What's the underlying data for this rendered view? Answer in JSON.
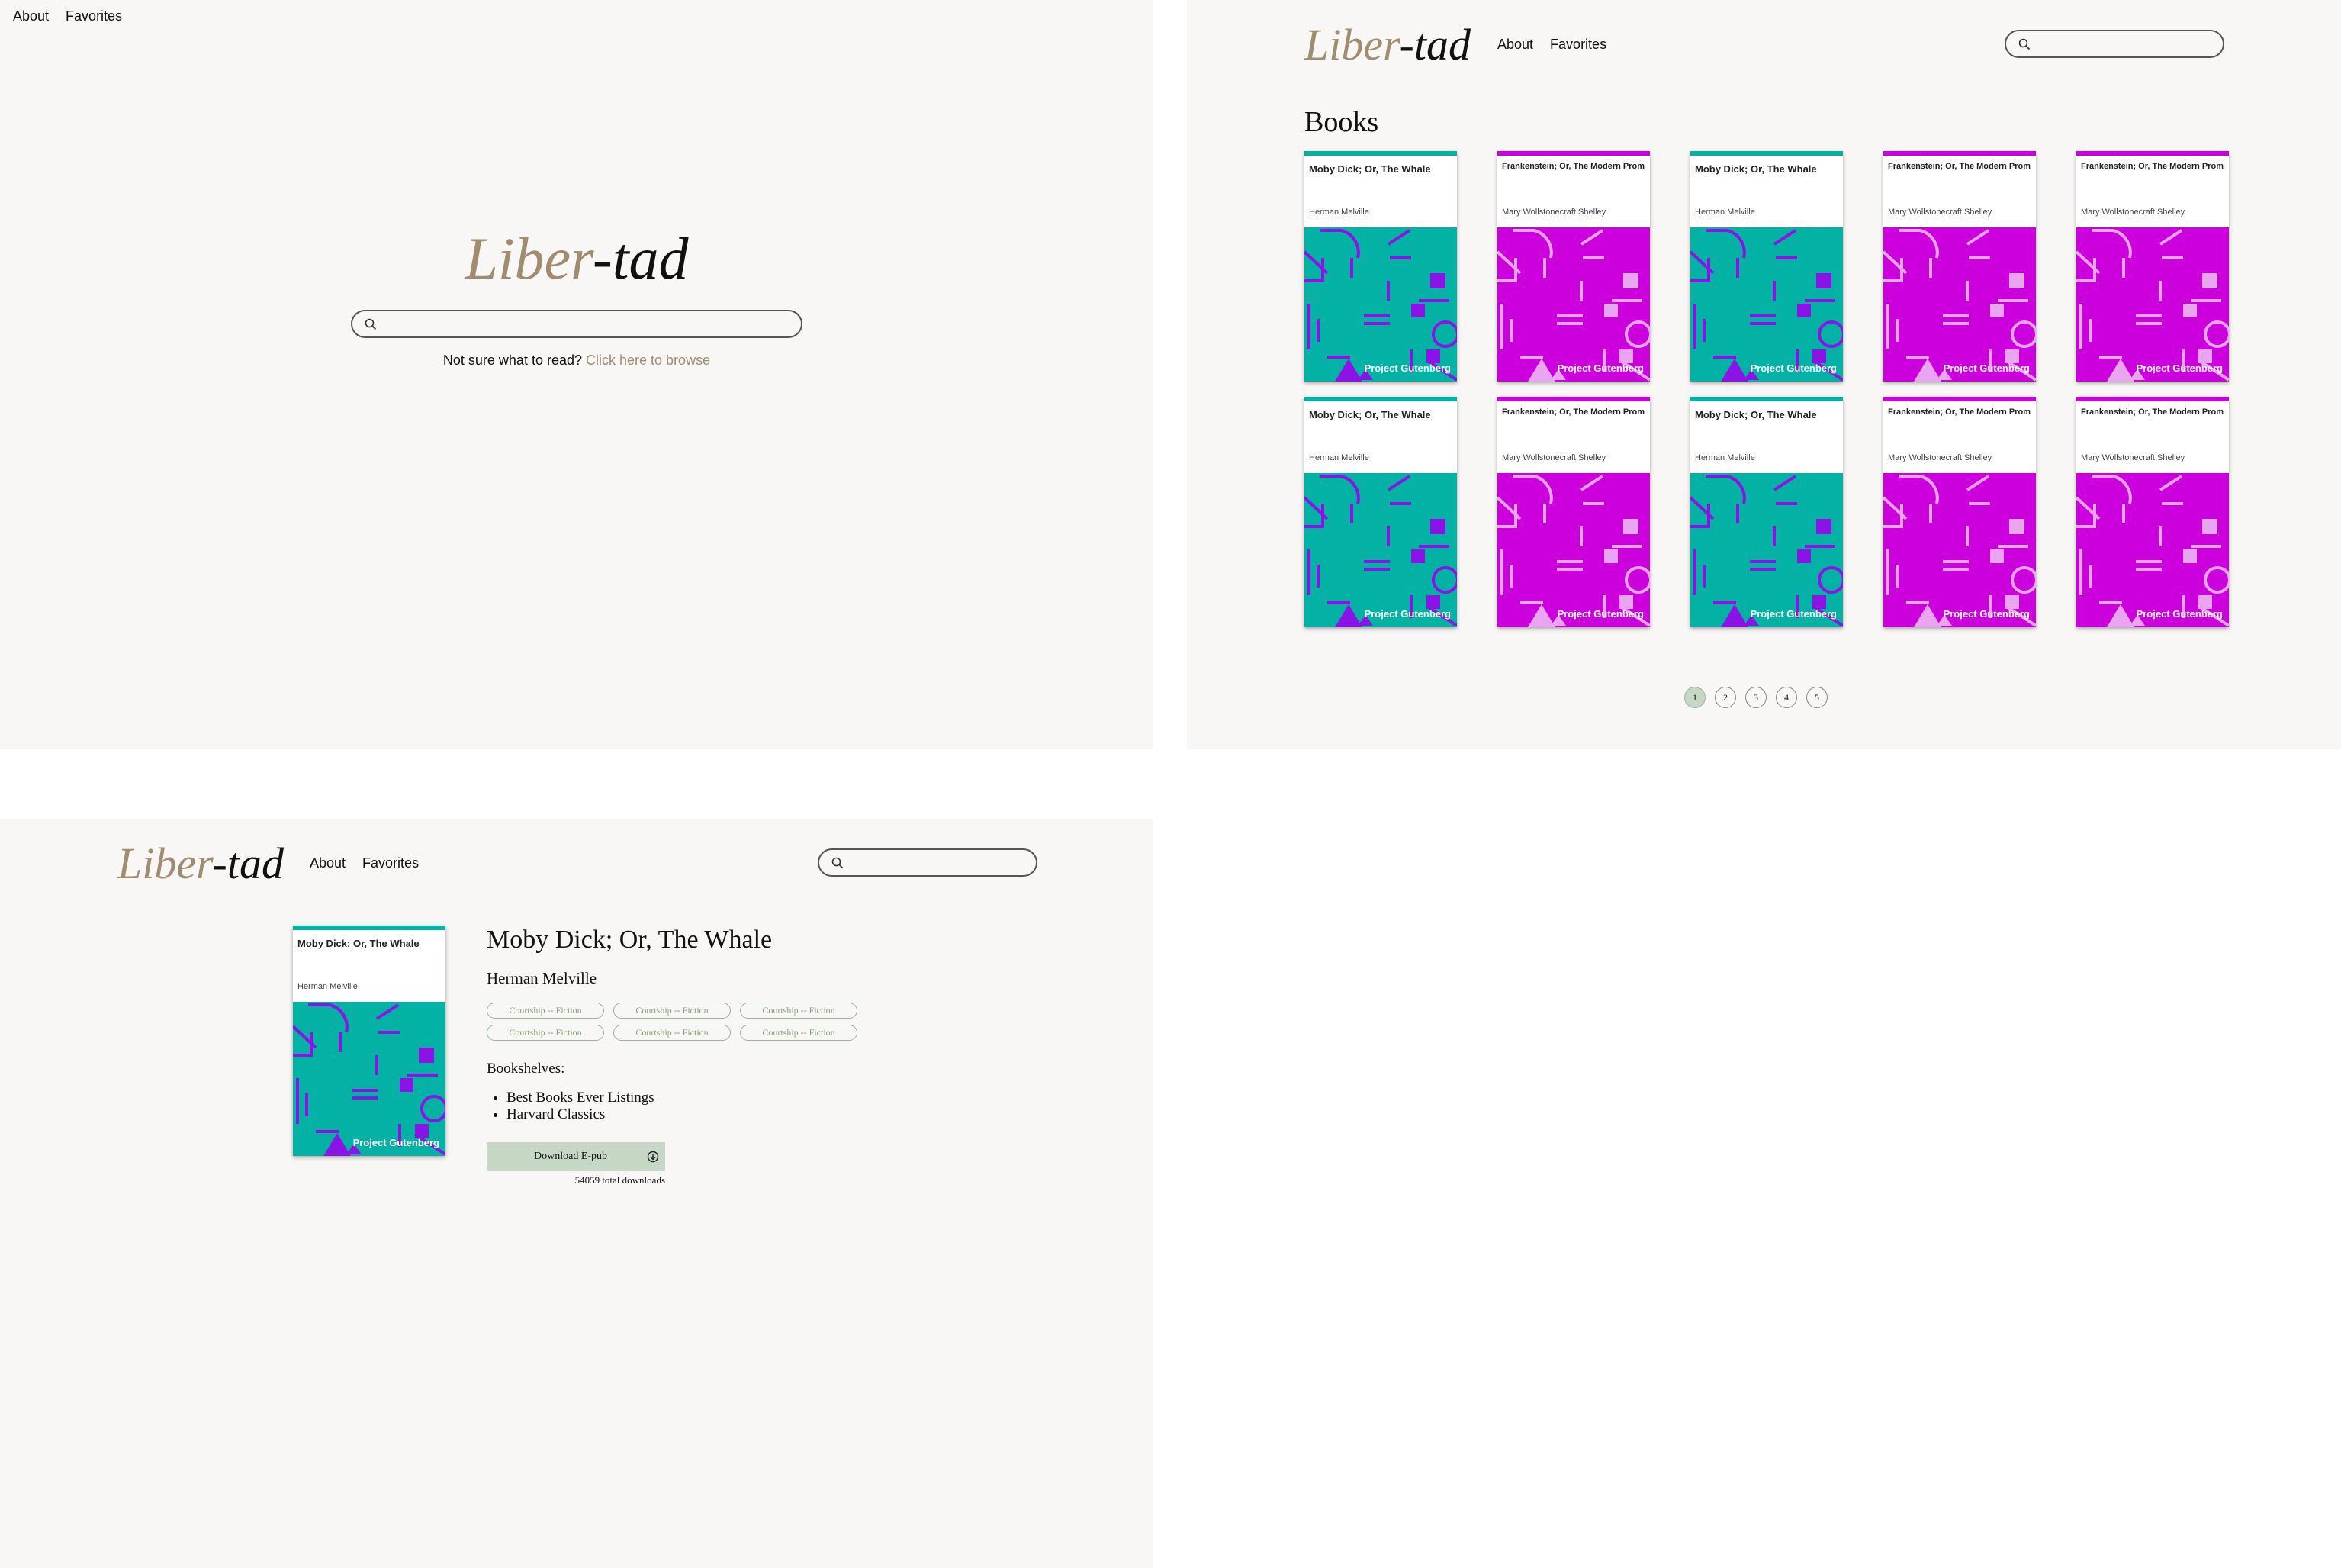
{
  "nav": {
    "about": "About",
    "favorites": "Favorites"
  },
  "logo": {
    "liber": "Liber",
    "tad": "-tad"
  },
  "home": {
    "prompt": "Not sure what to read?",
    "browse_link": "Click here to browse"
  },
  "browse": {
    "heading": "Books",
    "pages": [
      "1",
      "2",
      "3",
      "4",
      "5"
    ],
    "active_page": "1",
    "books": [
      {
        "title": "Moby Dick; Or, The Whale",
        "author": "Herman Melville",
        "cover": "teal"
      },
      {
        "title": "Frankenstein; Or, The Modern Prometheus",
        "author": "Mary Wollstonecraft Shelley",
        "cover": "magenta"
      },
      {
        "title": "Moby Dick; Or, The Whale",
        "author": "Herman Melville",
        "cover": "teal"
      },
      {
        "title": "Frankenstein; Or, The Modern Prometheus",
        "author": "Mary Wollstonecraft Shelley",
        "cover": "magenta"
      },
      {
        "title": "Frankenstein; Or, The Modern Prometheus",
        "author": "Mary Wollstonecraft Shelley",
        "cover": "magenta"
      },
      {
        "title": "Moby Dick; Or, The Whale",
        "author": "Herman Melville",
        "cover": "teal"
      },
      {
        "title": "Frankenstein; Or, The Modern Prometheus",
        "author": "Mary Wollstonecraft Shelley",
        "cover": "magenta"
      },
      {
        "title": "Moby Dick; Or, The Whale",
        "author": "Herman Melville",
        "cover": "teal"
      },
      {
        "title": "Frankenstein; Or, The Modern Prometheus",
        "author": "Mary Wollstonecraft Shelley",
        "cover": "magenta"
      },
      {
        "title": "Frankenstein; Or, The Modern Prometheus",
        "author": "Mary Wollstonecraft Shelley",
        "cover": "magenta"
      }
    ]
  },
  "cover_label": "Project Gutenberg",
  "colors": {
    "accent": "#a08c6e",
    "teal": "#04b2a5",
    "magenta": "#cc00dd",
    "purple": "#8a14e6",
    "sage": "#c7d7c6"
  },
  "detail": {
    "title": "Moby Dick; Or, The Whale",
    "author": "Herman Melville",
    "subjects": [
      "Courtship -- Fiction",
      "Courtship -- Fiction",
      "Courtship -- Fiction",
      "Courtship -- Fiction",
      "Courtship -- Fiction",
      "Courtship -- Fiction"
    ],
    "shelves_label": "Bookshelves:",
    "shelves": [
      "Best Books Ever Listings",
      "Harvard Classics"
    ],
    "download_label": "Download E-pub",
    "downloads": "54059 total downloads"
  },
  "icons": {
    "search": "search-icon",
    "download": "download-circle-icon"
  }
}
